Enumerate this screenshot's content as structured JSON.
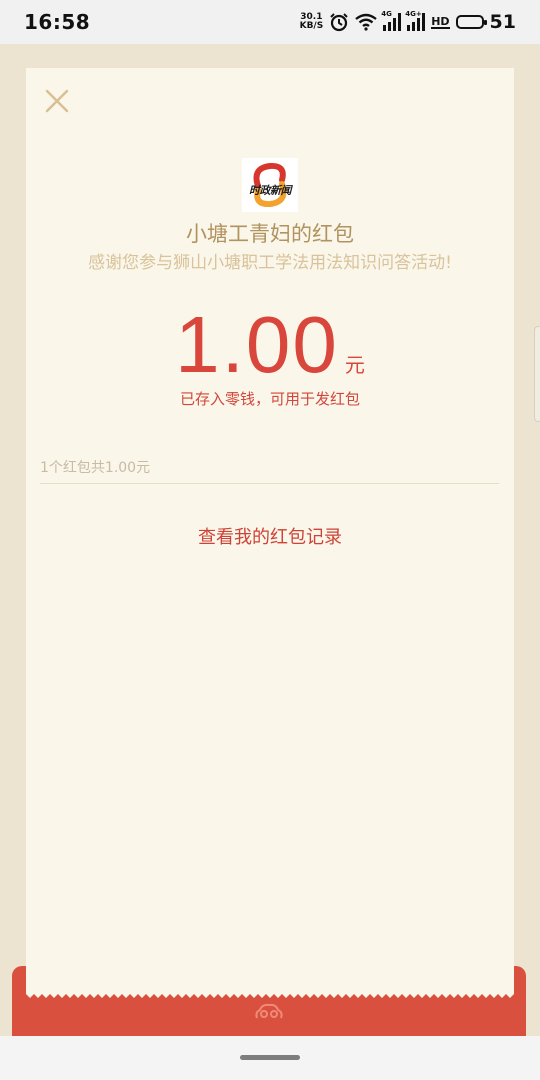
{
  "status_bar": {
    "time": "16:58",
    "net_speed_value": "30.1",
    "net_speed_unit": "KB/S",
    "sim1_tag": "4G",
    "sim2_tag": "4G+",
    "hd_label": "HD",
    "battery_level": "51",
    "icons": [
      "alarm-icon",
      "wifi-icon",
      "signal-icon",
      "signal-icon",
      "hd-icon",
      "battery-icon"
    ]
  },
  "card": {
    "close_icon": "close-icon",
    "logo_text": "时政新闻",
    "sender": "小塘工青妇的红包",
    "greeting": "感谢您参与狮山小塘职工学法用法知识问答活动!",
    "amount": "1.00",
    "currency": "元",
    "note": "已存入零钱，可用于发红包",
    "summary": "1个红包共1.00元",
    "record_link": "查看我的红包记录"
  },
  "colors": {
    "card_bg": "#fbf6ea",
    "page_bg": "#ece4d1",
    "accent_red": "#d9503f",
    "gold_text": "#b0935f"
  },
  "envelope": {
    "icon": "cloud-ornament-icon"
  }
}
